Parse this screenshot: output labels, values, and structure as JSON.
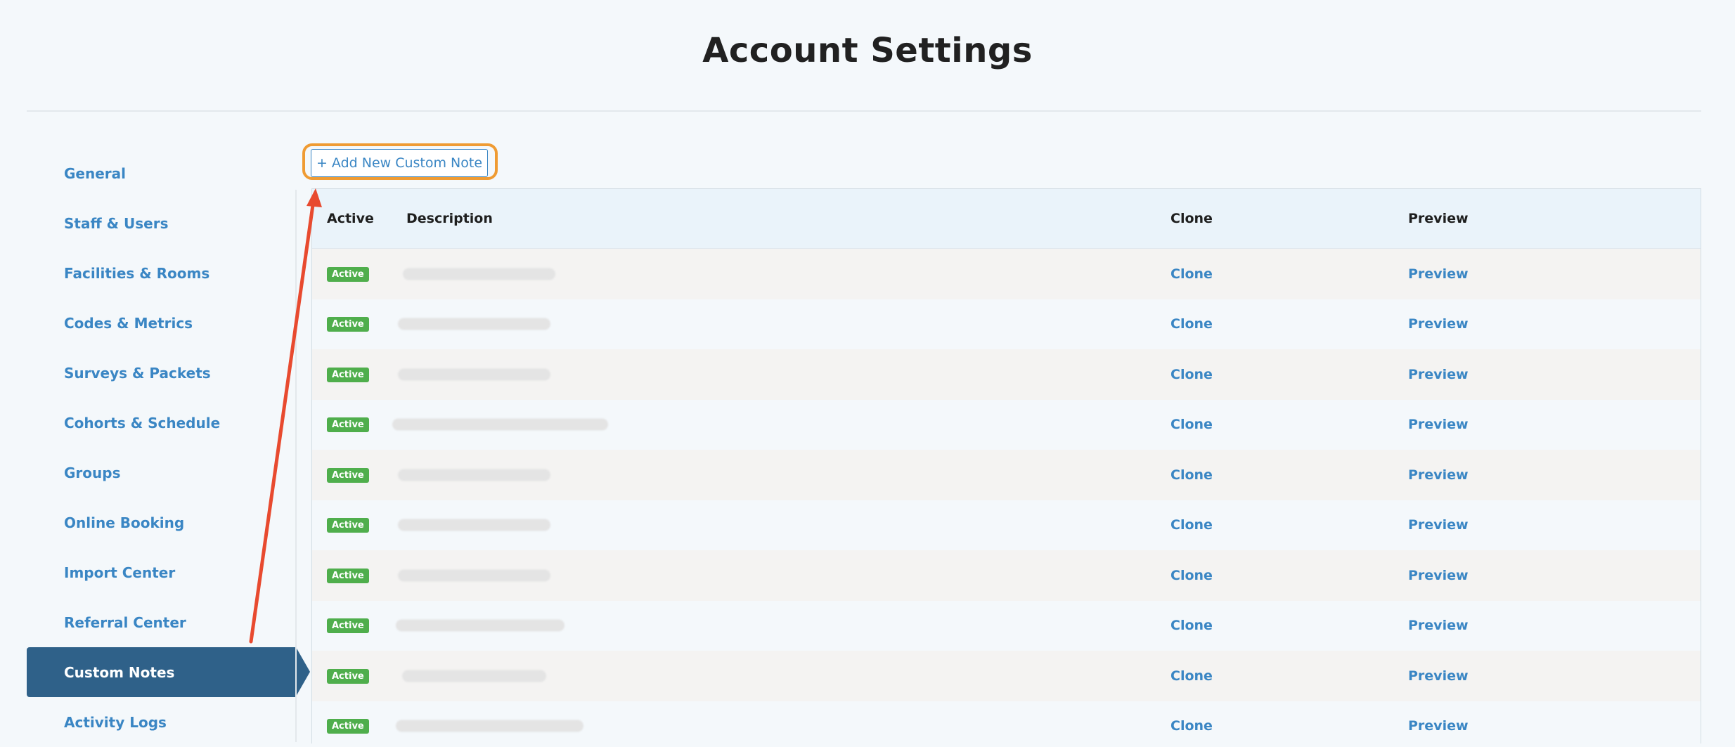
{
  "header": {
    "title": "Account Settings"
  },
  "sidebar": {
    "items": [
      {
        "label": "General"
      },
      {
        "label": "Staff & Users"
      },
      {
        "label": "Facilities & Rooms"
      },
      {
        "label": "Codes & Metrics"
      },
      {
        "label": "Surveys & Packets"
      },
      {
        "label": "Cohorts & Schedule"
      },
      {
        "label": "Groups"
      },
      {
        "label": "Online Booking"
      },
      {
        "label": "Import Center"
      },
      {
        "label": "Referral Center"
      },
      {
        "label": "Custom Notes",
        "active": true
      },
      {
        "label": "Activity Logs"
      }
    ]
  },
  "main": {
    "add_button_label": "+ Add New Custom Note",
    "table": {
      "columns": {
        "active": "Active",
        "description": "Description",
        "clone": "Clone",
        "preview": "Preview"
      },
      "rows": [
        {
          "status": "Active",
          "clone": "Clone",
          "preview": "Preview"
        },
        {
          "status": "Active",
          "clone": "Clone",
          "preview": "Preview"
        },
        {
          "status": "Active",
          "clone": "Clone",
          "preview": "Preview"
        },
        {
          "status": "Active",
          "clone": "Clone",
          "preview": "Preview"
        },
        {
          "status": "Active",
          "clone": "Clone",
          "preview": "Preview"
        },
        {
          "status": "Active",
          "clone": "Clone",
          "preview": "Preview"
        },
        {
          "status": "Active",
          "clone": "Clone",
          "preview": "Preview"
        },
        {
          "status": "Active",
          "clone": "Clone",
          "preview": "Preview"
        },
        {
          "status": "Active",
          "clone": "Clone",
          "preview": "Preview"
        },
        {
          "status": "Active",
          "clone": "Clone",
          "preview": "Preview"
        }
      ]
    }
  },
  "colors": {
    "accent": "#3a86c4",
    "active_nav": "#2f6189",
    "badge": "#4fae4c",
    "highlight": "#ef9b33",
    "arrow": "#e84a2f"
  }
}
